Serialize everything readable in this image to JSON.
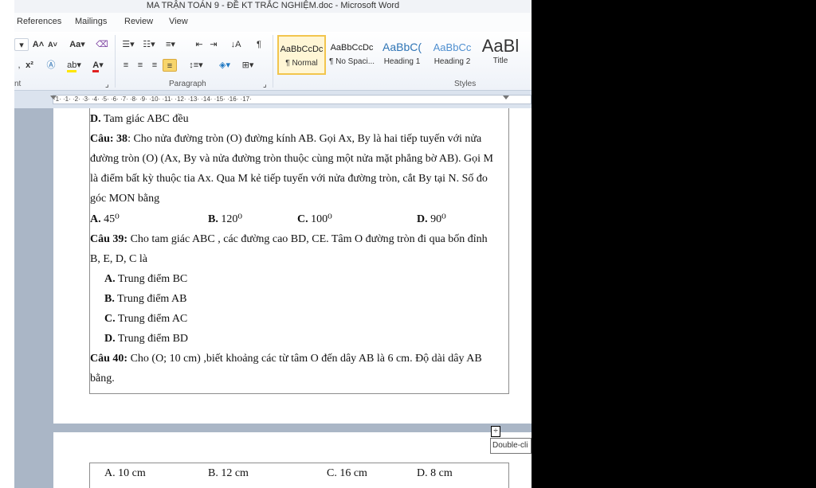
{
  "window": {
    "title": "MA TRẬN TOÁN 9 - ĐỀ KT TRẮC NGHIỆM.doc - Microsoft Word"
  },
  "tabs": [
    {
      "label": "References"
    },
    {
      "label": "Mailings"
    },
    {
      "label": "Review"
    },
    {
      "label": "View"
    }
  ],
  "ribbon": {
    "font_group_label": "nt",
    "paragraph_group_label": "Paragraph",
    "styles_group_label": "Styles",
    "grow_font": "A",
    "shrink_font": "A",
    "change_case": "Aa",
    "font_color_letter": "A",
    "styles": [
      {
        "sample": "AaBbCcDc",
        "name": "¶ Normal"
      },
      {
        "sample": "AaBbCcDc",
        "name": "¶ No Spaci..."
      },
      {
        "sample": "AaBbC(",
        "name": "Heading 1"
      },
      {
        "sample": "AaBbCc",
        "name": "Heading 2"
      },
      {
        "sample": "AaBl",
        "name": "Title"
      }
    ]
  },
  "ruler": {
    "ticks": "·1· ·1· ·2· ·3· ·4· ·5· ·6· ·7· ·8· ·9· ·10· ·11· ·12· ·13· ·14· ·15· ·16· ·17·"
  },
  "document": {
    "page1": {
      "line1_label": "D.",
      "line1_text": " Tam giác ABC đều",
      "q38_label": "Câu: 38",
      "q38_line1": ": Cho nửa đường tròn (O) đường kính AB. Gọi Ax, By là hai tiếp tuyến với nửa",
      "q38_line2": "đường tròn (O) (Ax, By và nửa đường tròn thuộc cùng một nửa mặt phẳng bờ AB). Gọi M",
      "q38_line3": "là điểm bất kỳ thuộc tia Ax. Qua M kẻ tiếp tuyến với nửa đường tròn, cắt By tại N. Số đo",
      "q38_line4": "góc MON bằng",
      "q38_answers": [
        {
          "label": "A.",
          "value": " 45⁰"
        },
        {
          "label": "B.",
          "value": " 120⁰"
        },
        {
          "label": "C.",
          "value": " 100⁰"
        },
        {
          "label": "D.",
          "value": " 90⁰"
        }
      ],
      "q39_label": "Câu 39:",
      "q39_line1": " Cho tam giác ABC , các đường cao BD, CE. Tâm O đường tròn đi qua bốn đỉnh",
      "q39_line2": "B, E, D, C  là",
      "q39_answers": [
        {
          "label": "A.",
          "value": " Trung điểm BC"
        },
        {
          "label": "B.",
          "value": " Trung điểm AB"
        },
        {
          "label": "C.",
          "value": " Trung điểm AC"
        },
        {
          "label": "D.",
          "value": " Trung điểm BD"
        }
      ],
      "q40_label": "Câu 40:",
      "q40_line1": " Cho (O; 10 cm) ,biết khoảng các từ tâm O đến dây AB là 6 cm. Độ dài dây AB",
      "q40_line2": "bằng."
    },
    "page2": {
      "q40_answers": [
        {
          "value": "A. 10 cm"
        },
        {
          "value": "B. 12 cm"
        },
        {
          "value": "C. 16 cm"
        },
        {
          "value": "D. 8 cm"
        }
      ]
    }
  },
  "tooltip": {
    "text": "Double-cli"
  },
  "colors": {
    "ribbon_bg": "#eef2f8",
    "doc_bg": "#aab6c6",
    "active_style": "#f2c54d",
    "heading_blue": "#2e74b5"
  }
}
